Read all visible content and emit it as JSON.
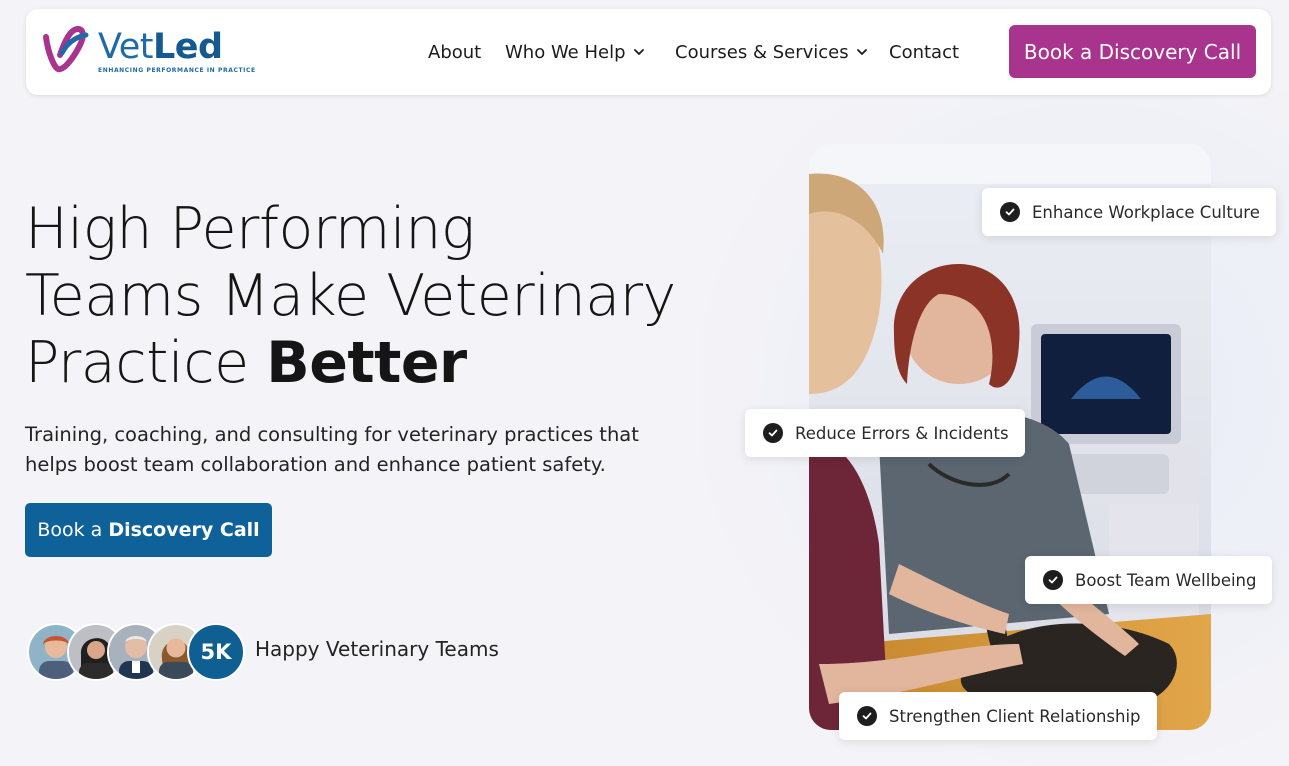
{
  "header": {
    "logo": {
      "word_part1": "Vet",
      "word_part2": "Led",
      "tagline": "ENHANCING PERFORMANCE IN PRACTICE",
      "colors": {
        "primary": "#1e6aa8",
        "accent": "#a8348e"
      }
    },
    "nav": [
      {
        "label": "About",
        "has_dropdown": false
      },
      {
        "label": "Who We Help",
        "has_dropdown": true
      },
      {
        "label": "Courses & Services",
        "has_dropdown": true
      },
      {
        "label": "Contact",
        "has_dropdown": false
      }
    ],
    "cta": {
      "prefix": "Book a ",
      "emphasis": "Discovery Call",
      "color": "#a8348e"
    }
  },
  "hero": {
    "title_line1": "High Performing",
    "title_line2": "Teams Make Veterinary",
    "title_line3_prefix": "Practice ",
    "title_line3_strong": "Better",
    "subtitle": "Training, coaching, and consulting for veterinary practices that helps boost team collaboration and enhance patient safety.",
    "cta": {
      "prefix": "Book a ",
      "emphasis": "Discovery Call",
      "color": "#0f6299"
    },
    "social_proof": {
      "count": "5K",
      "label": "Happy Veterinary Teams"
    }
  },
  "benefits": [
    {
      "label": "Enhance Workplace Culture",
      "icon": "check-circle-icon"
    },
    {
      "label": "Reduce Errors & Incidents",
      "icon": "check-circle-icon"
    },
    {
      "label": "Boost Team Wellbeing",
      "icon": "check-circle-icon"
    },
    {
      "label": "Strengthen Client Relationship",
      "icon": "check-circle-icon"
    }
  ]
}
